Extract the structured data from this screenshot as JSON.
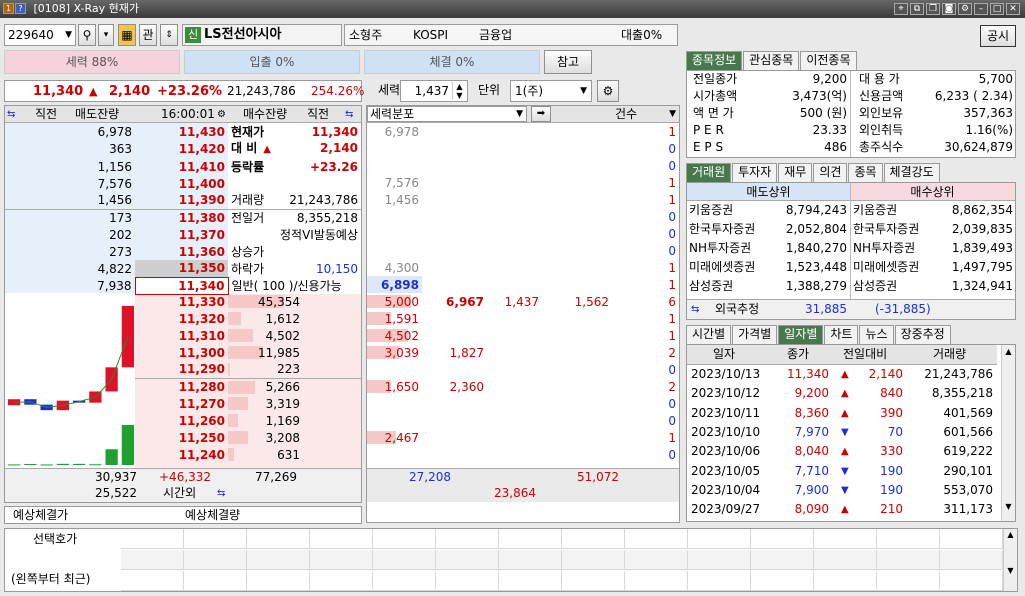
{
  "window": {
    "title": "[0108] X-Ray 현재가",
    "icon_num": "1",
    "icon_q": "?"
  },
  "toolbar": {
    "code": "229640",
    "kwan": "관",
    "sin": "신",
    "name": "LS전선아시아",
    "size": "소형주",
    "market": "KOSPI",
    "sector": "금융업",
    "loan": "대출0%",
    "gongsi": "공시"
  },
  "power": {
    "strength": "세력 88%",
    "inflow": "입출 0%",
    "exec": "체결 0%",
    "ref": "참고"
  },
  "price": {
    "cur": "11,340",
    "arrow": "▲",
    "diff": "2,140",
    "rate": "+23.26%",
    "vol": "21,243,786",
    "ratio": "254.26%",
    "force_label": "세력",
    "force_val": "1,437",
    "unit_label": "단위",
    "unit_val": "1(주)"
  },
  "ob_head": {
    "c1": "직전",
    "c2": "매도잔량",
    "c3": "16:00:01",
    "c4": "매수잔량",
    "c5": "직전"
  },
  "asks": [
    {
      "qty": "6,978",
      "price": "11,430",
      "fqty": "6,978",
      "cnt": "1"
    },
    {
      "qty": "363",
      "price": "11,420",
      "fqty": "",
      "cnt": "0"
    },
    {
      "qty": "1,156",
      "price": "11,410",
      "fqty": "",
      "cnt": "0"
    },
    {
      "qty": "7,576",
      "price": "11,400",
      "fqty": "7,576",
      "cnt": "1"
    },
    {
      "qty": "1,456",
      "price": "11,390",
      "fqty": "1,456",
      "cnt": "1"
    },
    {
      "qty": "173",
      "price": "11,380",
      "fqty": "",
      "cnt": "0"
    },
    {
      "qty": "202",
      "price": "11,370",
      "fqty": "",
      "cnt": "0"
    },
    {
      "qty": "273",
      "price": "11,360",
      "fqty": "",
      "cnt": "0"
    },
    {
      "qty": "4,822",
      "price": "11,350",
      "fqty": "4,300",
      "cnt": "1"
    },
    {
      "qty": "7,938",
      "price": "11,340",
      "fqty": "6,898",
      "cnt": "1"
    }
  ],
  "info": [
    {
      "k": "현재가",
      "v": "11,340"
    },
    {
      "k": "대 비",
      "a": "▲",
      "v": "2,140"
    },
    {
      "k": "등락률",
      "v": "+23.26"
    },
    {
      "k": "",
      "v": ""
    },
    {
      "k": "거래량",
      "v": "21,243,786"
    },
    {
      "k": "전일거",
      "v": "8,355,218"
    },
    {
      "k": "",
      "v": "정적VI발동예상"
    },
    {
      "k": "상승가",
      "v": ""
    },
    {
      "k": "하락가",
      "v": "10,150"
    },
    {
      "k": "일반( 100 )/신용가능",
      "v": ""
    }
  ],
  "bids": [
    {
      "price": "11,330",
      "qty": "45,354",
      "f1": "5,000",
      "f2": "6,967",
      "f3": "1,437",
      "f4": "1,562",
      "cnt": "6",
      "bar": 80
    },
    {
      "price": "11,320",
      "qty": "1,612",
      "f1": "1,591",
      "f2": "",
      "f3": "",
      "f4": "",
      "cnt": "1",
      "bar": 18
    },
    {
      "price": "11,310",
      "qty": "4,502",
      "f1": "4,502",
      "f2": "",
      "f3": "",
      "f4": "",
      "cnt": "1",
      "bar": 35
    },
    {
      "price": "11,300",
      "qty": "11,985",
      "f1": "3,039",
      "f2": "1,827",
      "f3": "",
      "f4": "",
      "cnt": "2",
      "bar": 50
    },
    {
      "price": "11,290",
      "qty": "223",
      "f1": "",
      "f2": "",
      "f3": "",
      "f4": "",
      "cnt": "0",
      "bar": 3
    },
    {
      "price": "11,280",
      "qty": "5,266",
      "f1": "1,650",
      "f2": "2,360",
      "f3": "",
      "f4": "",
      "cnt": "2",
      "bar": 38
    },
    {
      "price": "11,270",
      "qty": "3,319",
      "f1": "",
      "f2": "",
      "f3": "",
      "f4": "",
      "cnt": "0",
      "bar": 28
    },
    {
      "price": "11,260",
      "qty": "1,169",
      "f1": "",
      "f2": "",
      "f3": "",
      "f4": "",
      "cnt": "0",
      "bar": 14
    },
    {
      "price": "11,250",
      "qty": "3,208",
      "f1": "2,467",
      "f2": "",
      "f3": "",
      "f4": "",
      "cnt": "1",
      "bar": 28
    },
    {
      "price": "11,240",
      "qty": "631",
      "f1": "",
      "f2": "",
      "f3": "",
      "f4": "",
      "cnt": "0",
      "bar": 8
    }
  ],
  "ob_foot": {
    "ask_total": "30,937",
    "net": "+46,332",
    "bid_total": "77,269",
    "ask_after": "25,522",
    "after_label": "시간외",
    "f_total1": "27,208",
    "f_total2": "51,072",
    "f_total3": "23,864"
  },
  "force_head": {
    "label": "세력분포",
    "cnt": "건수"
  },
  "expect": {
    "label1": "예상체결가",
    "label2": "예상체결량"
  },
  "bottom": {
    "row1": "선택호가",
    "row3": "(왼쪽부터 최근)"
  },
  "right_tabs": [
    "종목정보",
    "관심종목",
    "이전종목"
  ],
  "stock_info": [
    {
      "k": "전일종가",
      "v": "9,200",
      "k2": "대 용 가",
      "v2": "5,700"
    },
    {
      "k": "시가총액",
      "v": "3,473(억)",
      "k2": "신용금액",
      "v2": "6,233  ( 2.34)"
    },
    {
      "k": "액 면 가",
      "v": "500 (원)",
      "k2": "외인보유",
      "v2": "357,363"
    },
    {
      "k": "P E R",
      "v": "23.33",
      "k2": "외인취득",
      "v2": "1.16(%)"
    },
    {
      "k": "E P S",
      "v": "486",
      "k2": "총주식수",
      "v2": "30,624,879"
    }
  ],
  "broker_tabs": [
    "거래원",
    "투자자",
    "재무",
    "의견",
    "종목",
    "체결강도"
  ],
  "broker_head": {
    "sell": "매도상위",
    "buy": "매수상위"
  },
  "brokers": [
    {
      "sn": "키움증권",
      "sv": "8,794,243",
      "bn": "키움증권",
      "bv": "8,862,354"
    },
    {
      "sn": "한국투자증권",
      "sv": "2,052,804",
      "bn": "한국투자증권",
      "bv": "2,039,835"
    },
    {
      "sn": "NH투자증권",
      "sv": "1,840,270",
      "bn": "NH투자증권",
      "bv": "1,839,493"
    },
    {
      "sn": "미래에셋증권",
      "sv": "1,523,448",
      "bn": "미래에셋증권",
      "bv": "1,497,795"
    },
    {
      "sn": "삼성증권",
      "sv": "1,388,279",
      "bn": "삼성증권",
      "bv": "1,324,941"
    }
  ],
  "foreign": {
    "label": "외국추정",
    "sell": "31,885",
    "buy": "(-31,885)"
  },
  "daily_tabs": [
    "시간별",
    "가격별",
    "일자별",
    "차트",
    "뉴스",
    "장중추정"
  ],
  "daily_head": {
    "date": "일자",
    "close": "종가",
    "diff": "전일대비",
    "vol": "거래량"
  },
  "daily": [
    {
      "date": "2023/10/13",
      "close": "11,340",
      "dir": "up",
      "arrow": "▲",
      "diff": "2,140",
      "vol": "21,243,786"
    },
    {
      "date": "2023/10/12",
      "close": "9,200",
      "dir": "up",
      "arrow": "▲",
      "diff": "840",
      "vol": "8,355,218"
    },
    {
      "date": "2023/10/11",
      "close": "8,360",
      "dir": "up",
      "arrow": "▲",
      "diff": "390",
      "vol": "401,569"
    },
    {
      "date": "2023/10/10",
      "close": "7,970",
      "dir": "down",
      "arrow": "▼",
      "diff": "70",
      "vol": "601,566"
    },
    {
      "date": "2023/10/06",
      "close": "8,040",
      "dir": "up",
      "arrow": "▲",
      "diff": "330",
      "vol": "619,222"
    },
    {
      "date": "2023/10/05",
      "close": "7,710",
      "dir": "down",
      "arrow": "▼",
      "diff": "190",
      "vol": "290,101"
    },
    {
      "date": "2023/10/04",
      "close": "7,900",
      "dir": "down",
      "arrow": "▼",
      "diff": "190",
      "vol": "553,070"
    },
    {
      "date": "2023/09/27",
      "close": "8,090",
      "dir": "up",
      "arrow": "▲",
      "diff": "210",
      "vol": "311,173"
    }
  ],
  "colors": {
    "up": "#cc0000",
    "down": "#1b2fd6",
    "ask_bg": "#e6f0fb",
    "bid_bg": "#fbe9e9",
    "tab_on": "#47794d",
    "accent": "#3a62c0"
  }
}
